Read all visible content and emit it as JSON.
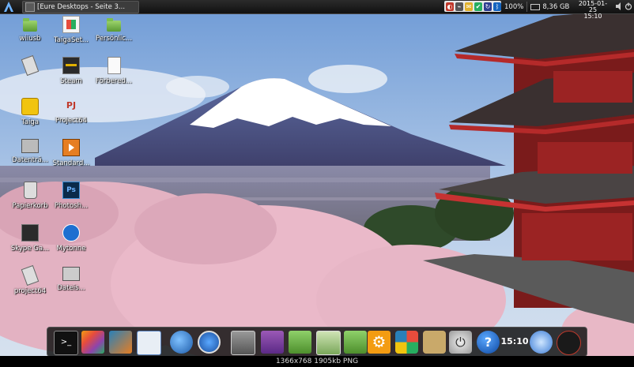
{
  "top_panel": {
    "window_title": "[Eure Desktops - Seite 3...",
    "battery": "100%",
    "disk": "8,36 GB",
    "date": "2015-01-25",
    "time": "15:10",
    "tray_icons": [
      "cpu-monitor-icon",
      "network-icon",
      "chat-icon",
      "sync-icon",
      "update-icon",
      "bluetooth-icon"
    ]
  },
  "desktop_icons": [
    {
      "label": "wiiusb",
      "icon": "folder-icon"
    },
    {
      "label": "TaigaSet...",
      "icon": "windows-installer-icon"
    },
    {
      "label": "Persönlic...",
      "icon": "folder-icon"
    },
    {
      "label": "",
      "icon": "usb-drive-icon"
    },
    {
      "label": "Steam",
      "icon": "steam-icon"
    },
    {
      "label": "Förbered...",
      "icon": "text-document-icon"
    },
    {
      "label": "Taiga",
      "icon": "taiga-icon"
    },
    {
      "label": "Project64",
      "icon": "project64-icon"
    },
    {
      "label": "Datenträ...",
      "icon": "drive-icon"
    },
    {
      "label": "Standard...",
      "icon": "media-player-icon"
    },
    {
      "label": "Papierkorb",
      "icon": "trash-icon"
    },
    {
      "label": "Photosh...",
      "icon": "photoshop-icon"
    },
    {
      "label": "Skype Ga...",
      "icon": "skype-game-icon"
    },
    {
      "label": "Mytonne",
      "icon": "update-app-icon"
    },
    {
      "label": "project64",
      "icon": "usb-drive-icon"
    },
    {
      "label": "Dateis...",
      "icon": "drive-icon"
    }
  ],
  "dock": {
    "items": [
      {
        "name": "terminal-icon"
      },
      {
        "name": "paint-icon"
      },
      {
        "name": "image-viewer-icon"
      },
      {
        "name": "document-viewer-icon"
      },
      {
        "name": "network-globe-icon"
      },
      {
        "name": "update-manager-icon"
      },
      {
        "name": "download-manager-icon"
      },
      {
        "name": "audio-player-icon"
      },
      {
        "name": "folder-icon"
      },
      {
        "name": "text-editor-icon"
      },
      {
        "name": "folder-icon"
      },
      {
        "name": "settings-icon"
      },
      {
        "name": "windows-icon"
      },
      {
        "name": "clock-app-icon"
      },
      {
        "name": "power-icon"
      },
      {
        "name": "help-icon"
      },
      {
        "name": "browser-icon"
      },
      {
        "name": "system-monitor-icon"
      }
    ],
    "clock": "15:10"
  },
  "caption": "1366x768  1905kb  PNG",
  "colors": {
    "panel": "#1a1a1a",
    "folder": "#7cbf4f",
    "sky": "#8fb6e0",
    "blossom": "#e8b8c8",
    "pagoda": "#8b1f1f"
  }
}
